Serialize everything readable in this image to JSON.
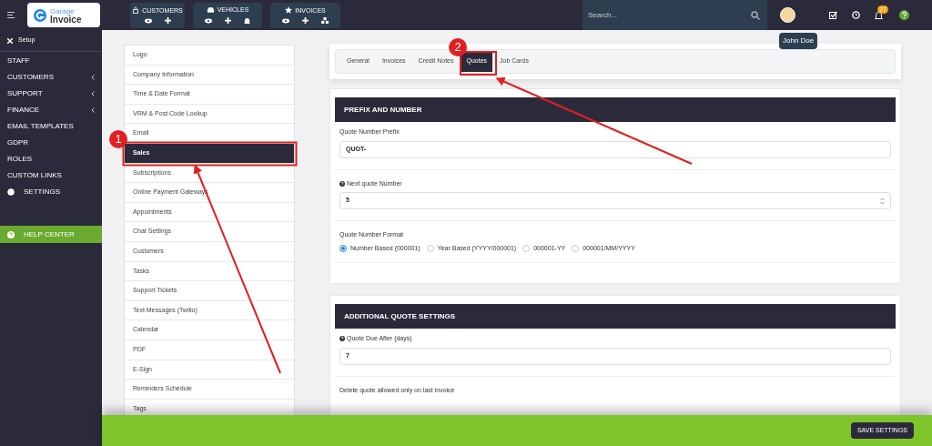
{
  "topbar": {
    "quick_groups": [
      {
        "label": "CUSTOMERS"
      },
      {
        "label": "VEHICLES"
      },
      {
        "label": "INVOICES"
      }
    ],
    "search": {
      "placeholder": "Search..."
    },
    "notifications_count": "27",
    "avatar_tooltip": "John Doe"
  },
  "logo": {
    "line1": "Garage",
    "line2": "Invoice"
  },
  "sidebar": {
    "header": "Setup",
    "items": [
      {
        "label": "STAFF",
        "expandable": false
      },
      {
        "label": "CUSTOMERS",
        "expandable": true
      },
      {
        "label": "SUPPORT",
        "expandable": true
      },
      {
        "label": "FINANCE",
        "expandable": true
      },
      {
        "label": "EMAIL TEMPLATES",
        "expandable": false
      },
      {
        "label": "GDPR",
        "expandable": false
      },
      {
        "label": "ROLES",
        "expandable": false
      },
      {
        "label": "CUSTOM LINKS",
        "expandable": false
      },
      {
        "label": "SETTINGS",
        "expandable": false
      }
    ],
    "help": "HELP CENTER"
  },
  "settings_menu": [
    {
      "label": "Logo",
      "selected": false
    },
    {
      "label": "Company Information",
      "selected": false
    },
    {
      "label": "Time & Date Format",
      "selected": false
    },
    {
      "label": "VRM & Post Code Lookup",
      "selected": false
    },
    {
      "label": "Email",
      "selected": false
    },
    {
      "label": "Sales",
      "selected": true
    },
    {
      "label": "Subscriptions",
      "selected": false
    },
    {
      "label": "Online Payment Gateways",
      "selected": false
    },
    {
      "label": "Appointments",
      "selected": false
    },
    {
      "label": "Chat Settings",
      "selected": false
    },
    {
      "label": "Customers",
      "selected": false
    },
    {
      "label": "Tasks",
      "selected": false
    },
    {
      "label": "Support Tickets",
      "selected": false
    },
    {
      "label": "Text Messages (Twilio)",
      "selected": false
    },
    {
      "label": "Calendar",
      "selected": false
    },
    {
      "label": "PDF",
      "selected": false
    },
    {
      "label": "E-Sign",
      "selected": false
    },
    {
      "label": "Reminders Schedule",
      "selected": false
    },
    {
      "label": "Tags",
      "selected": false
    }
  ],
  "tabs": [
    {
      "label": "General",
      "selected": false
    },
    {
      "label": "Invoices",
      "selected": false
    },
    {
      "label": "Credit Notes",
      "selected": false
    },
    {
      "label": "Quotes",
      "selected": true
    },
    {
      "label": "Job Cards",
      "selected": false
    }
  ],
  "sections": [
    {
      "title": "PREFIX AND NUMBER",
      "fields": [
        {
          "kind": "text",
          "label": "Quote Number Prefix",
          "help": false,
          "value": "QUOT-"
        },
        {
          "kind": "number",
          "label": "Next quote Number",
          "help": true,
          "value": "5"
        },
        {
          "kind": "radio",
          "label": "Quote Number Format",
          "options": [
            {
              "label": "Number Based (000001)",
              "selected": true
            },
            {
              "label": "Year Based (YYYY/000001)",
              "selected": false
            },
            {
              "label": "000001-YY",
              "selected": false
            },
            {
              "label": "000001/MM/YYYY",
              "selected": false
            }
          ]
        }
      ]
    },
    {
      "title": "ADDITIONAL QUOTE SETTINGS",
      "fields": [
        {
          "kind": "text",
          "label": "Quote Due After (days)",
          "help": true,
          "value": "7"
        },
        {
          "kind": "caption",
          "label": "Delete quote allowed only on last invoice"
        }
      ]
    }
  ],
  "footer": {
    "button": "SAVE SETTINGS"
  },
  "annotations": [
    {
      "number": "1"
    },
    {
      "number": "2"
    }
  ]
}
